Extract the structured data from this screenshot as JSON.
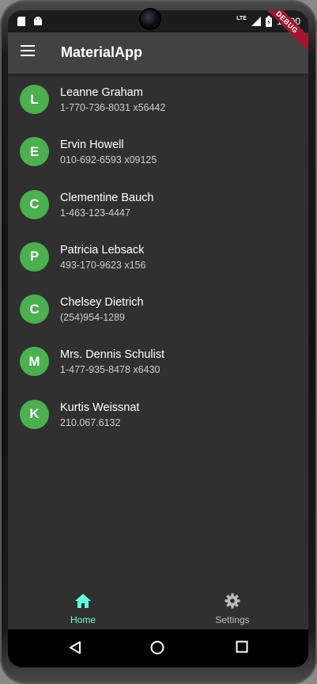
{
  "status_bar": {
    "time": "12:00",
    "network": "LTE"
  },
  "app_bar": {
    "title": "MaterialApp"
  },
  "debug_banner": "DEBUG",
  "contacts": [
    {
      "initial": "L",
      "name": "Leanne Graham",
      "phone": "1-770-736-8031 x56442"
    },
    {
      "initial": "E",
      "name": "Ervin Howell",
      "phone": "010-692-6593 x09125"
    },
    {
      "initial": "C",
      "name": "Clementine Bauch",
      "phone": "1-463-123-4447"
    },
    {
      "initial": "P",
      "name": "Patricia Lebsack",
      "phone": "493-170-9623 x156"
    },
    {
      "initial": "C",
      "name": "Chelsey Dietrich",
      "phone": "(254)954-1289"
    },
    {
      "initial": "M",
      "name": "Mrs. Dennis Schulist",
      "phone": "1-477-935-8478 x6430"
    },
    {
      "initial": "K",
      "name": "Kurtis Weissnat",
      "phone": "210.067.6132"
    }
  ],
  "bottom_nav": [
    {
      "label": "Home",
      "icon": "home-icon",
      "active": true
    },
    {
      "label": "Settings",
      "icon": "gear-icon",
      "active": false
    }
  ],
  "colors": {
    "accent": "#64ffda",
    "avatar": "#4caf50",
    "app_bar": "#424242",
    "background": "#303030",
    "debug_banner": "#a3162d"
  }
}
